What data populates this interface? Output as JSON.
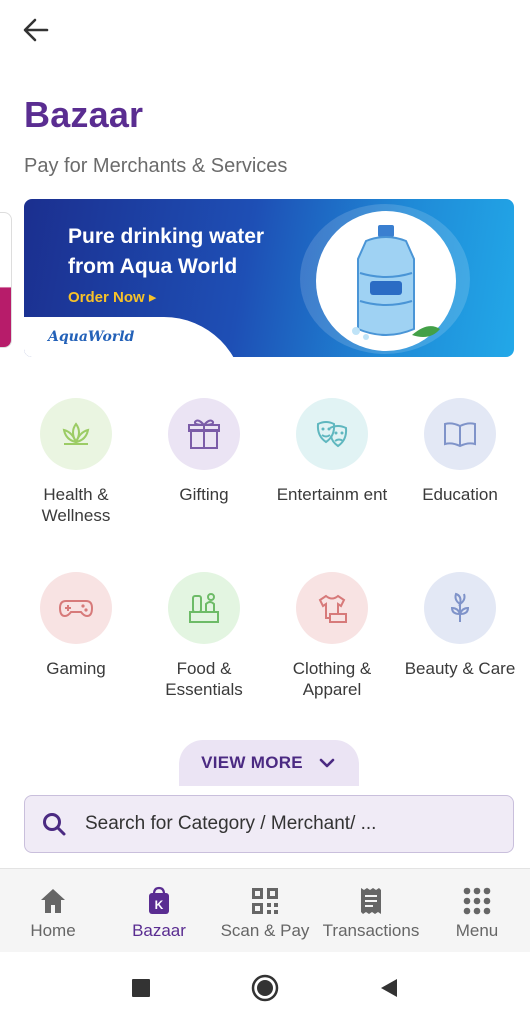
{
  "header": {
    "title": "Bazaar",
    "subtitle": "Pay for Merchants & Services"
  },
  "banner": {
    "line1": "Pure drinking water",
    "line2": "from Aqua World",
    "cta": "Order Now ▸",
    "logo_text": "AquaWorld"
  },
  "categories": [
    {
      "label": "Health & Wellness",
      "icon": "lotus-icon",
      "bg": "#eaf5e1",
      "color": "#9ccc65"
    },
    {
      "label": "Gifting",
      "icon": "gift-icon",
      "bg": "#ebe4f4",
      "color": "#7b5ca8"
    },
    {
      "label": "Entertainm ent",
      "icon": "theater-masks-icon",
      "bg": "#e1f3f4",
      "color": "#5fb7bf"
    },
    {
      "label": "Education",
      "icon": "book-icon",
      "bg": "#e3e8f5",
      "color": "#7f93c9"
    },
    {
      "label": "Gaming",
      "icon": "gamepad-icon",
      "bg": "#f8e3e3",
      "color": "#d77a7a"
    },
    {
      "label": "Food & Essentials",
      "icon": "grocery-icon",
      "bg": "#e3f5e1",
      "color": "#6dbb67"
    },
    {
      "label": "Clothing & Apparel",
      "icon": "tshirt-icon",
      "bg": "#f8e3e3",
      "color": "#d77a7a"
    },
    {
      "label": "Beauty & Care",
      "icon": "plant-icon",
      "bg": "#e3e8f5",
      "color": "#7f93c9"
    }
  ],
  "view_more": {
    "label": "VIEW MORE"
  },
  "search": {
    "placeholder": "Search for Category / Merchant/ ..."
  },
  "bottom_nav": [
    {
      "label": "Home",
      "icon": "home-icon",
      "active": false
    },
    {
      "label": "Bazaar",
      "icon": "bazaar-bag-icon",
      "active": true
    },
    {
      "label": "Scan & Pay",
      "icon": "qr-code-icon",
      "active": false
    },
    {
      "label": "Transactions",
      "icon": "receipt-icon",
      "active": false
    },
    {
      "label": "Menu",
      "icon": "grid-dots-icon",
      "active": false
    }
  ],
  "colors": {
    "brand": "#5a2d91",
    "banner_dark": "#1b2f8f",
    "banner_light": "#22a8e8",
    "cta": "#f7c229"
  }
}
